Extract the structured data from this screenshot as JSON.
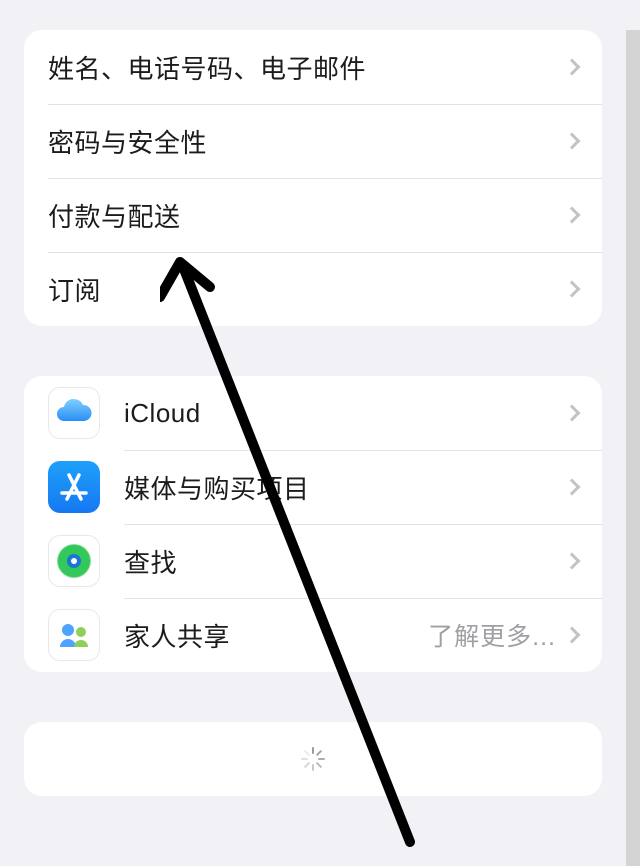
{
  "group1": {
    "items": [
      {
        "label": "姓名、电话号码、电子邮件"
      },
      {
        "label": "密码与安全性"
      },
      {
        "label": "付款与配送"
      },
      {
        "label": "订阅"
      }
    ]
  },
  "group2": {
    "items": [
      {
        "label": "iCloud"
      },
      {
        "label": "媒体与购买项目"
      },
      {
        "label": "查找"
      },
      {
        "label": "家人共享",
        "detail": "了解更多..."
      }
    ]
  }
}
